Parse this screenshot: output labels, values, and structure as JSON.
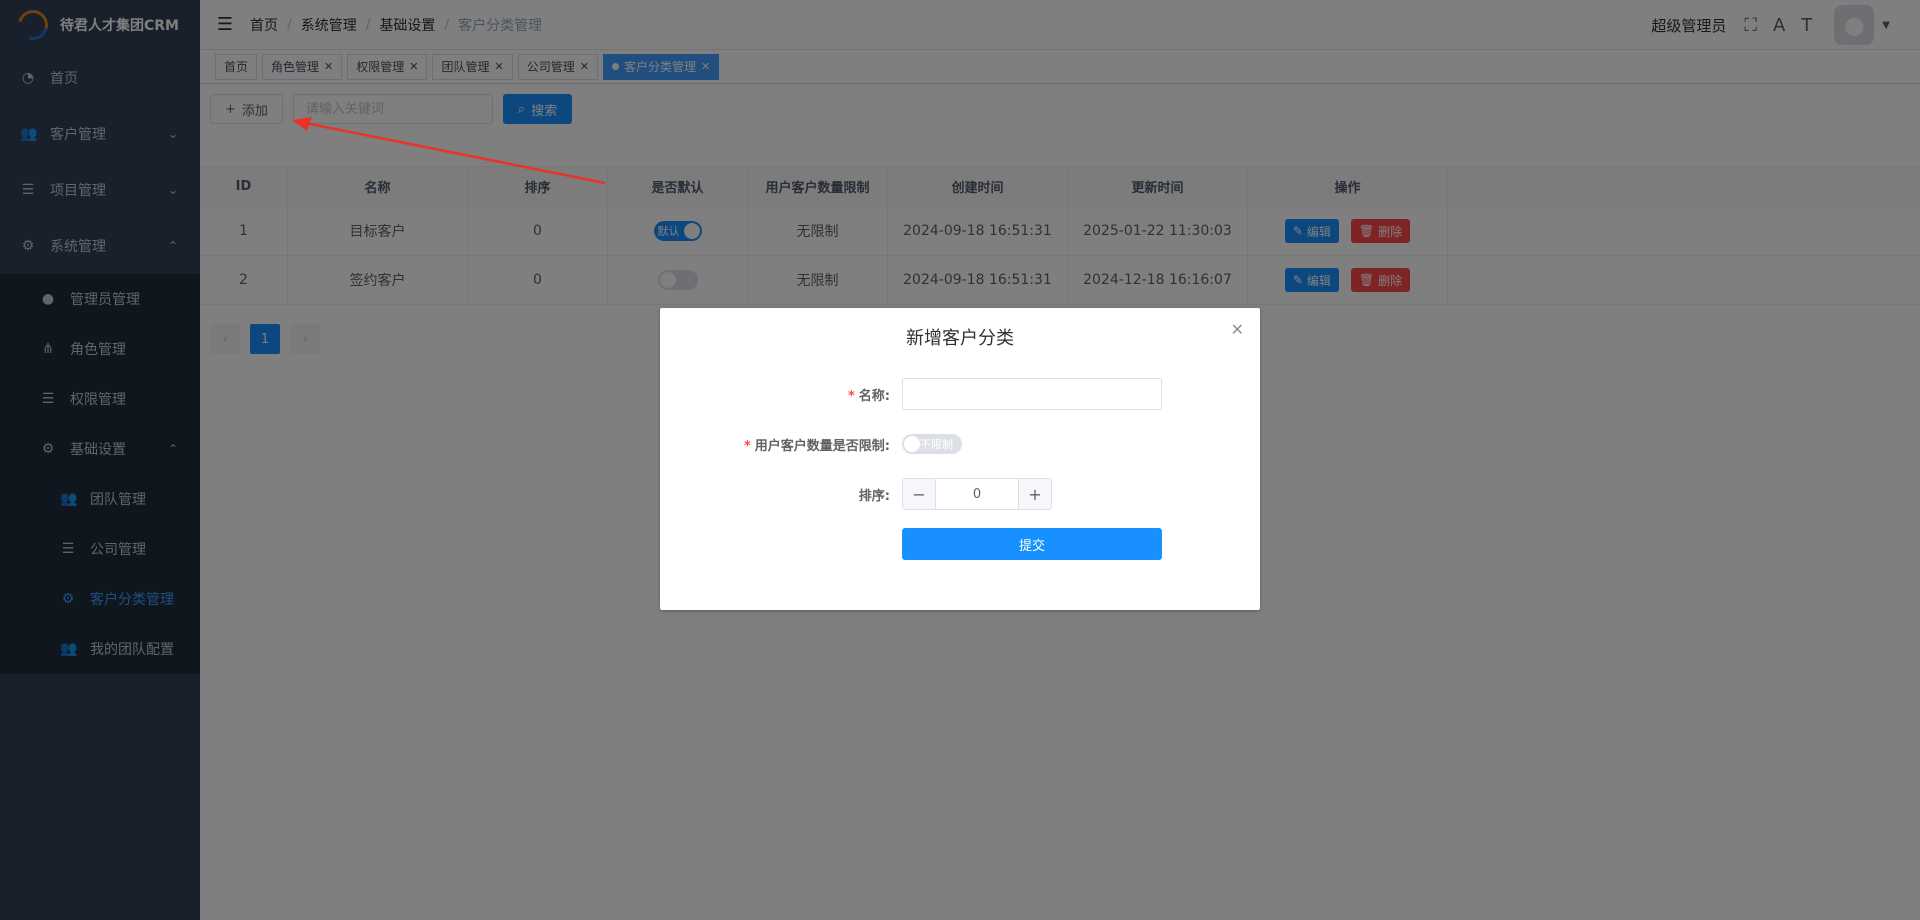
{
  "app": {
    "title": "待君人才集团CRM"
  },
  "sidebar": {
    "items": [
      {
        "label": "首页",
        "icon": "dashboard-icon"
      },
      {
        "label": "客户管理",
        "icon": "users-icon"
      },
      {
        "label": "项目管理",
        "icon": "list-icon"
      },
      {
        "label": "系统管理",
        "icon": "sliders-icon"
      }
    ],
    "system_sub": [
      {
        "label": "管理员管理",
        "icon": "user-icon"
      },
      {
        "label": "角色管理",
        "icon": "org-icon"
      },
      {
        "label": "权限管理",
        "icon": "list-icon"
      },
      {
        "label": "基础设置",
        "icon": "sliders-icon"
      }
    ],
    "base_sub": [
      {
        "label": "团队管理",
        "icon": "users-icon"
      },
      {
        "label": "公司管理",
        "icon": "list-icon"
      },
      {
        "label": "客户分类管理",
        "icon": "sliders-icon"
      },
      {
        "label": "我的团队配置",
        "icon": "users-icon"
      }
    ]
  },
  "header": {
    "breadcrumb": [
      "首页",
      "系统管理",
      "基础设置",
      "客户分类管理"
    ],
    "user": "超级管理员"
  },
  "tags": [
    {
      "label": "首页"
    },
    {
      "label": "角色管理"
    },
    {
      "label": "权限管理"
    },
    {
      "label": "团队管理"
    },
    {
      "label": "公司管理"
    },
    {
      "label": "客户分类管理"
    }
  ],
  "toolbar": {
    "add_label": "添加",
    "search_placeholder": "请输入关键词",
    "search_label": "搜索"
  },
  "table": {
    "columns": [
      "ID",
      "名称",
      "排序",
      "是否默认",
      "用户客户数量限制",
      "创建时间",
      "更新时间",
      "操作"
    ],
    "rows": [
      {
        "id": "1",
        "name": "目标客户",
        "sort": "0",
        "default_label": "默认",
        "limit": "无限制",
        "created": "2024-09-18 16:51:31",
        "updated": "2025-01-22 11:30:03",
        "edit": "编辑",
        "del": "删除"
      },
      {
        "id": "2",
        "name": "签约客户",
        "sort": "0",
        "default_label": "",
        "limit": "无限制",
        "created": "2024-09-18 16:51:31",
        "updated": "2024-12-18 16:16:07",
        "edit": "编辑",
        "del": "删除"
      }
    ]
  },
  "pagination": {
    "current": "1"
  },
  "dialog": {
    "title": "新增客户分类",
    "name_label": "名称:",
    "limit_label": "用户客户数量是否限制:",
    "limit_switch": "不限制",
    "sort_label": "排序:",
    "sort_value": "0",
    "submit_label": "提交"
  },
  "colors": {
    "primary": "#1890ff",
    "danger": "#ff4949",
    "sidebar": "#304156"
  }
}
